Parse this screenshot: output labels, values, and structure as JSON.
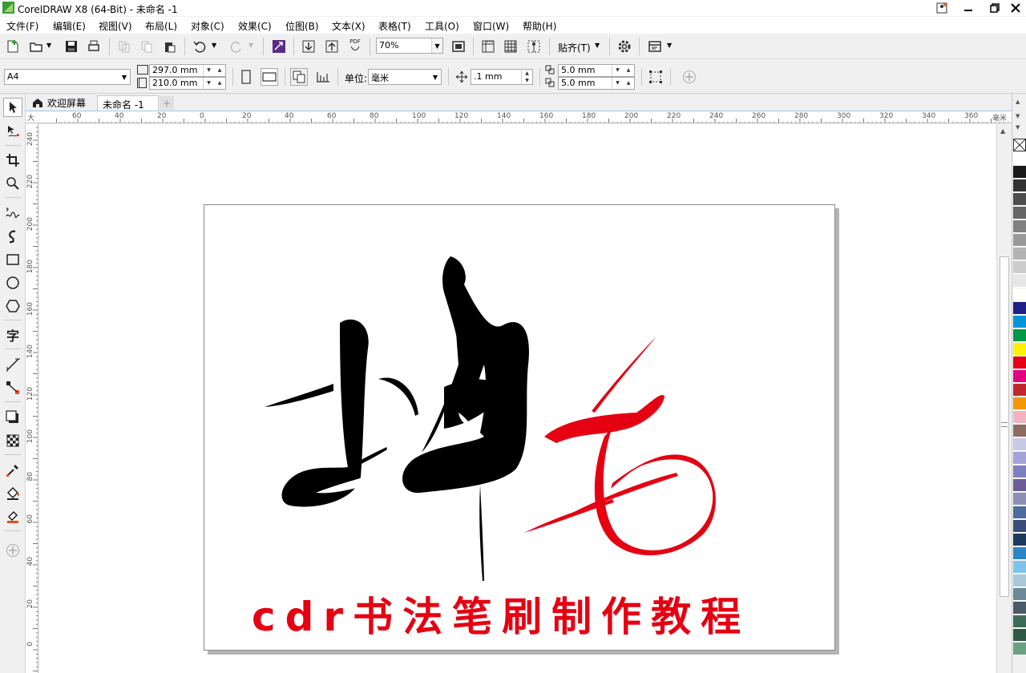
{
  "app": {
    "title": "CorelDRAW X8 (64-Bit) - 未命名 -1",
    "window_controls": [
      "info-icon",
      "minimize-icon",
      "restore-icon",
      "close-icon"
    ]
  },
  "menu": [
    "文件(F)",
    "编辑(E)",
    "视图(V)",
    "布局(L)",
    "对象(C)",
    "效果(C)",
    "位图(B)",
    "文本(X)",
    "表格(T)",
    "工具(O)",
    "窗口(W)",
    "帮助(H)"
  ],
  "std_toolbar": {
    "pdf_label": "PDF",
    "zoom_value": "70%",
    "snap_label": "贴齐(T)"
  },
  "prop_toolbar": {
    "page_size": "A4",
    "width": "297.0 mm",
    "height": "210.0 mm",
    "units_label": "单位:",
    "units_value": "毫米",
    "nudge_value": ".1 mm",
    "dup_x": "5.0 mm",
    "dup_y": "5.0 mm"
  },
  "tabs": {
    "welcome": "欢迎屏幕",
    "document": "未命名 -1"
  },
  "rulers": {
    "h_unit": "毫米",
    "v_unit": "毫米",
    "h_labels": [
      "60",
      "40",
      "20",
      "0",
      "20",
      "40",
      "60",
      "80",
      "100",
      "120",
      "140",
      "160",
      "180",
      "200",
      "220",
      "240",
      "260",
      "280",
      "300",
      "320",
      "340",
      "360"
    ],
    "v_labels": [
      "240",
      "220",
      "200",
      "180",
      "160",
      "140",
      "120",
      "100",
      "80",
      "60",
      "40",
      "20",
      "0"
    ]
  },
  "canvas": {
    "caption": "cdr书法笔刷制作教程",
    "calligraphy_colors": {
      "black_strokes": "#000000",
      "red_strokes": "#e50012"
    }
  },
  "palette": [
    "#ffffff",
    "#1a1a1a",
    "#333333",
    "#4d4d4d",
    "#666666",
    "#808080",
    "#999999",
    "#b3b3b3",
    "#cccccc",
    "#e6e6e6",
    "#ffffff",
    "#1d2088",
    "#0095d9",
    "#009944",
    "#fff100",
    "#e60012",
    "#e4007f",
    "#c1272d",
    "#f39800",
    "#f4b3c2",
    "#8c6c60",
    "#c9c9e8",
    "#a3a3d9",
    "#7f7fbf",
    "#6b5c99",
    "#8e8eb8",
    "#4f6c9c",
    "#3b4c7a",
    "#1e3a5f",
    "#2b86c8",
    "#7ec4e8",
    "#a9c9d9",
    "#6a8a99",
    "#4a5a66",
    "#3d6b5a",
    "#2e5948",
    "#6aa084"
  ]
}
